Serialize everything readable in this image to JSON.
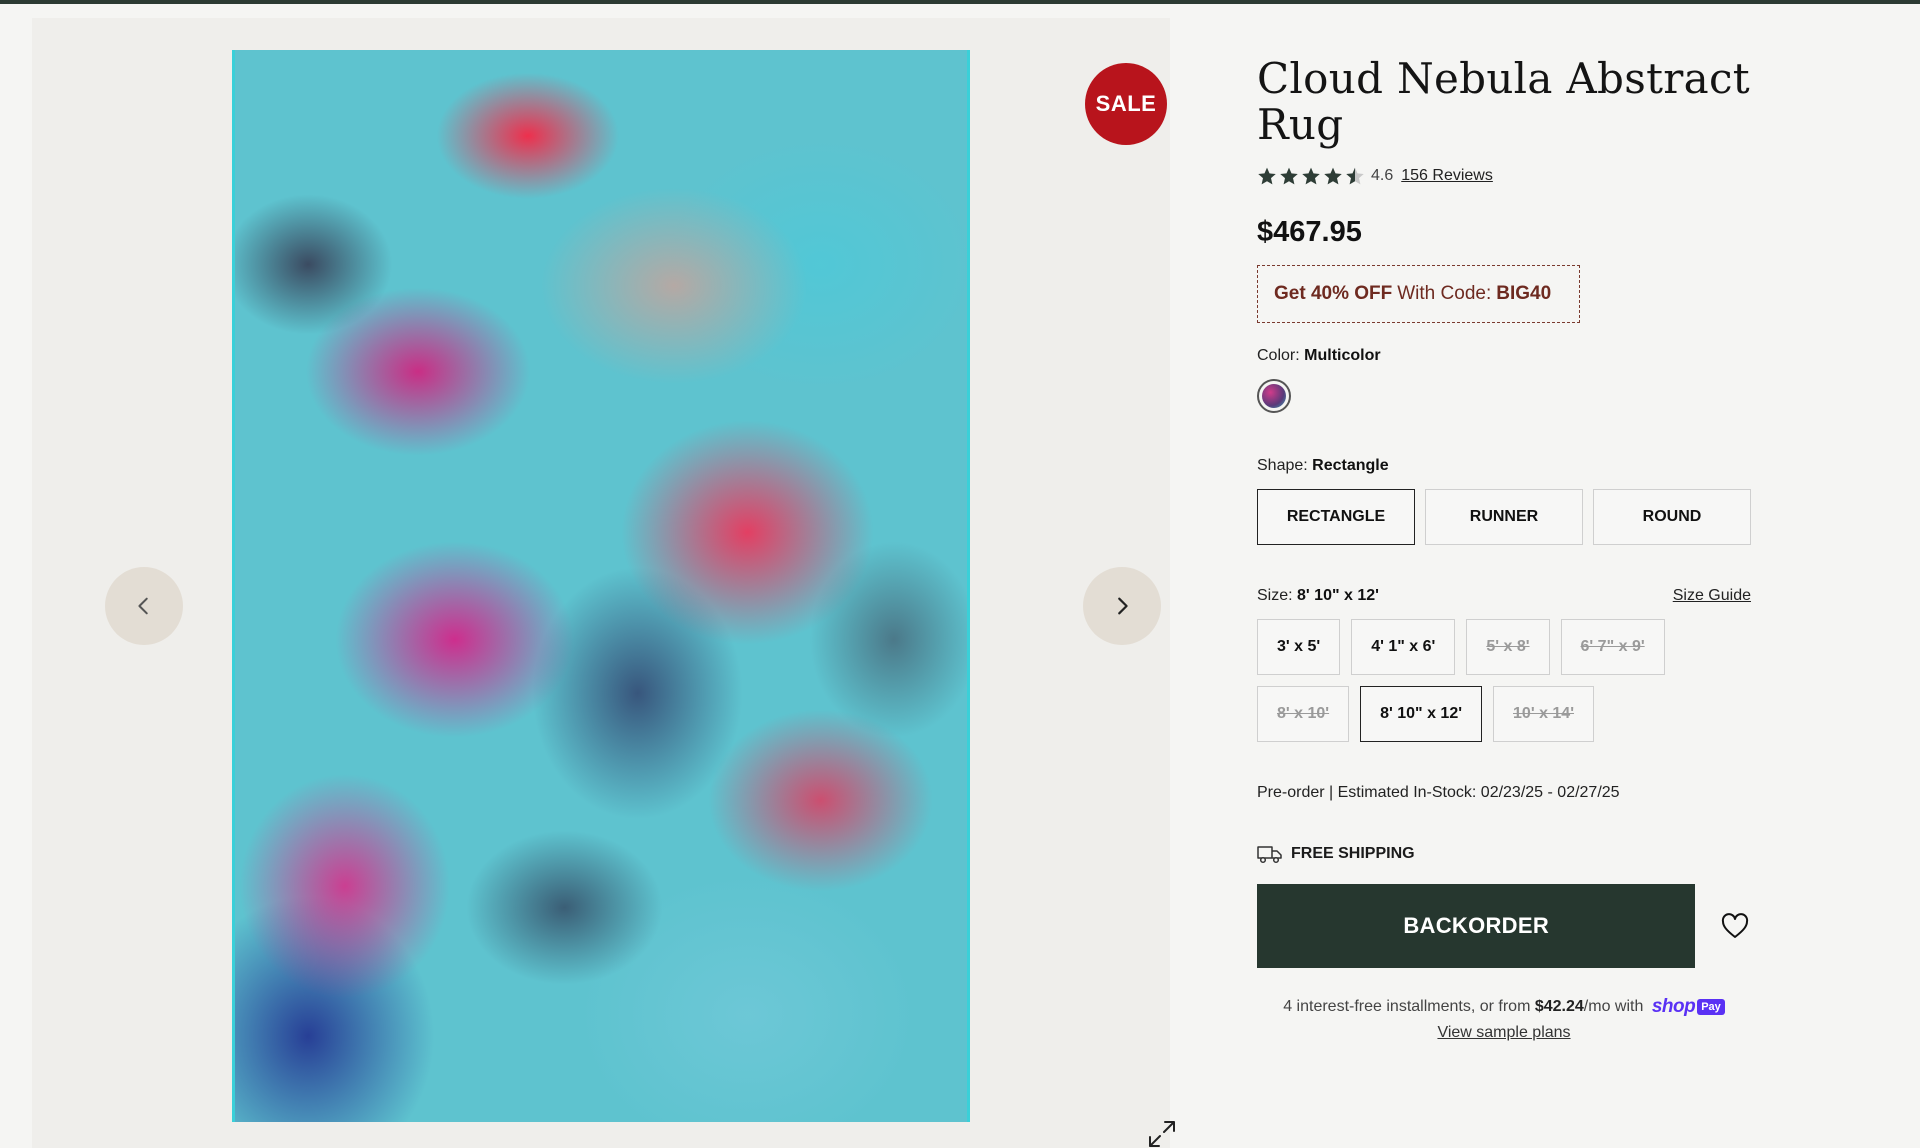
{
  "product": {
    "title": "Cloud Nebula Abstract Rug",
    "rating": "4.6",
    "stars": 4.5,
    "reviews_label": "156 Reviews",
    "price": "$467.95"
  },
  "gallery": {
    "sale_badge": "SALE"
  },
  "promo": {
    "prefix": "Get 40% OFF",
    "middle": "With Code:",
    "code": "BIG40"
  },
  "color": {
    "label": "Color:",
    "value": "Multicolor"
  },
  "shape": {
    "label": "Shape:",
    "value": "Rectangle",
    "options": [
      {
        "label": "RECTANGLE",
        "selected": true
      },
      {
        "label": "RUNNER",
        "selected": false
      },
      {
        "label": "ROUND",
        "selected": false
      }
    ]
  },
  "size": {
    "label": "Size:",
    "value": "8' 10\" x 12'",
    "guide_label": "Size Guide",
    "options": [
      {
        "label": "3' x 5'",
        "state": "available"
      },
      {
        "label": "4' 1\" x 6'",
        "state": "available"
      },
      {
        "label": "5' x 8'",
        "state": "unavailable"
      },
      {
        "label": "6' 7\" x 9'",
        "state": "unavailable"
      },
      {
        "label": "8' x 10'",
        "state": "unavailable"
      },
      {
        "label": "8' 10\" x 12'",
        "state": "selected"
      },
      {
        "label": "10' x 14'",
        "state": "unavailable"
      }
    ]
  },
  "availability": {
    "text": "Pre-order | Estimated In-Stock: 02/23/25 - 02/27/25"
  },
  "shipping": {
    "label": "FREE SHIPPING"
  },
  "cta": {
    "backorder_label": "BACKORDER"
  },
  "installments": {
    "prefix": "4 interest-free installments, or from",
    "amount": "$42.24",
    "suffix": "/mo with",
    "brand": "shop",
    "brand_pay": "Pay",
    "link": "View sample plans"
  },
  "colors": {
    "accent_dark_green": "#26372f",
    "sale_red": "#b8141c",
    "promo_brown": "#6e2a20",
    "shoppay_purple": "#5a31f4"
  }
}
